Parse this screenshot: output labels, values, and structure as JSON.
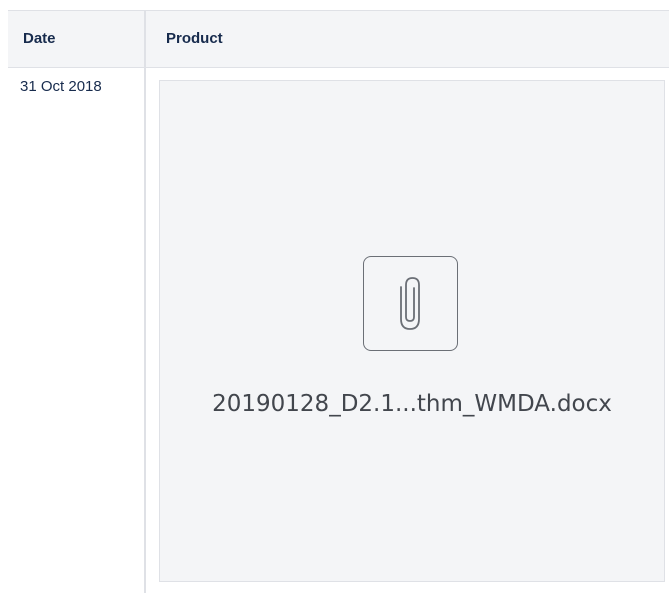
{
  "table": {
    "headers": {
      "date": "Date",
      "product": "Product"
    },
    "rows": [
      {
        "date": "31 Oct 2018",
        "attachment": {
          "file_name": "20190128_D2.1...thm_WMDA.docx",
          "icon": "paperclip-icon"
        }
      }
    ]
  },
  "colors": {
    "header_bg": "#f4f5f7",
    "border": "#dfe1e6",
    "text": "#172b4d",
    "attachment_bg": "#f4f5f7",
    "icon_stroke": "#6b6f76"
  }
}
